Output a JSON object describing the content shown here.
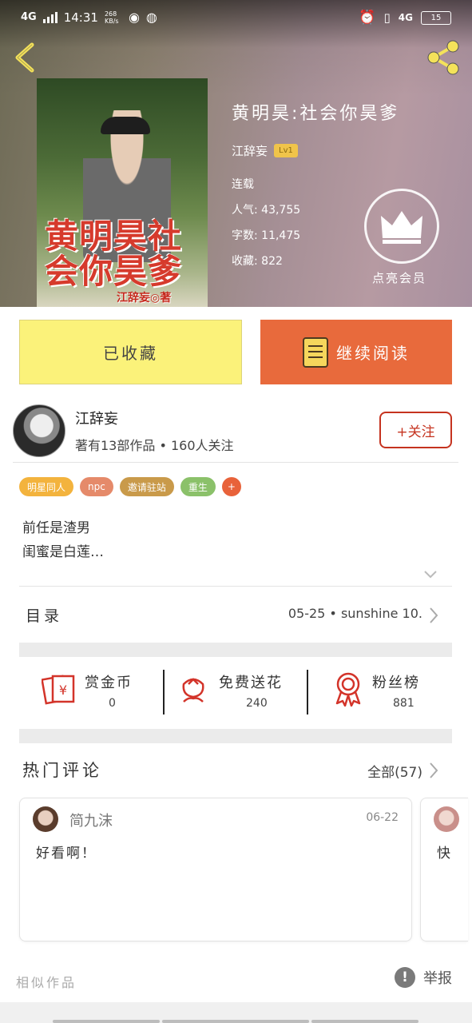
{
  "status_bar": {
    "network": "4G",
    "time": "14:31",
    "speed": "268 KB/s",
    "right_network": "4G",
    "battery": "15"
  },
  "book": {
    "title": "黄明昊:社会你昊爹",
    "author": "江辞妄",
    "level": "Lv1",
    "status": "连载",
    "popularity": "人气: 43,755",
    "word_count": "字数: 11,475",
    "favorites": "收藏: 822",
    "cover_title": "黄明昊社会你昊爹",
    "cover_author": "江辞妄◎著"
  },
  "vip": {
    "label": "点亮会员"
  },
  "actions": {
    "collect_label": "已收藏",
    "read_label": "继续阅读"
  },
  "author": {
    "name": "江辞妄",
    "stats": "著有13部作品 • 160人关注",
    "follow_label": "+关注"
  },
  "tags": [
    {
      "label": "明星同人",
      "color": "#f3b33d"
    },
    {
      "label": "npc",
      "color": "#e58a6a"
    },
    {
      "label": "邀请驻站",
      "color": "#c99a4a"
    },
    {
      "label": "重生",
      "color": "#8bc16a"
    },
    {
      "label": "+",
      "color": "#e8623a"
    }
  ],
  "description": {
    "line1": "前任是渣男",
    "line2": "闺蜜是白莲…"
  },
  "toc": {
    "label": "目录",
    "latest": "05-25 • sunshine 10."
  },
  "rewards": [
    {
      "label": "赏金币",
      "value": "0",
      "icon": "red-envelope-icon"
    },
    {
      "label": "免费送花",
      "value": "240",
      "icon": "flower-icon"
    },
    {
      "label": "粉丝榜",
      "value": "881",
      "icon": "medal-icon"
    }
  ],
  "hot_comments": {
    "title": "热门评论",
    "all_label": "全部(57)",
    "comments": [
      {
        "name": "简九沫",
        "date": "06-22",
        "text": "好看啊！"
      },
      {
        "name": "",
        "date": "",
        "text": "快"
      }
    ]
  },
  "footer": {
    "similar_label": "相似作品",
    "report_label": "举报"
  },
  "colors": {
    "accent_orange": "#e86a3c",
    "collect_yellow": "#fbf27a",
    "follow_red": "#c5331f"
  }
}
